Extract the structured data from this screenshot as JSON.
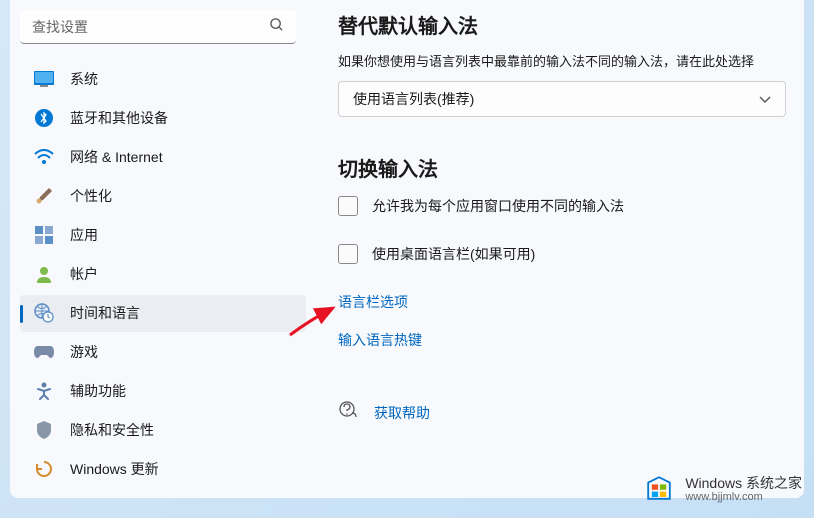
{
  "search": {
    "placeholder": "查找设置"
  },
  "sidebar": {
    "items": [
      {
        "label": "系统"
      },
      {
        "label": "蓝牙和其他设备"
      },
      {
        "label": "网络 & Internet"
      },
      {
        "label": "个性化"
      },
      {
        "label": "应用"
      },
      {
        "label": "帐户"
      },
      {
        "label": "时间和语言"
      },
      {
        "label": "游戏"
      },
      {
        "label": "辅助功能"
      },
      {
        "label": "隐私和安全性"
      },
      {
        "label": "Windows 更新"
      }
    ]
  },
  "content": {
    "section1_title": "替代默认输入法",
    "section1_desc": "如果你想使用与语言列表中最靠前的输入法不同的输入法，请在此处选择",
    "dropdown_value": "使用语言列表(推荐)",
    "section2_title": "切换输入法",
    "checkbox1_label": "允许我为每个应用窗口使用不同的输入法",
    "checkbox2_label": "使用桌面语言栏(如果可用)",
    "link1": "语言栏选项",
    "link2": "输入语言热键",
    "help_label": "获取帮助"
  },
  "watermark": {
    "title": "Windows 系统之家",
    "url": "www.bjjmlv.com"
  }
}
